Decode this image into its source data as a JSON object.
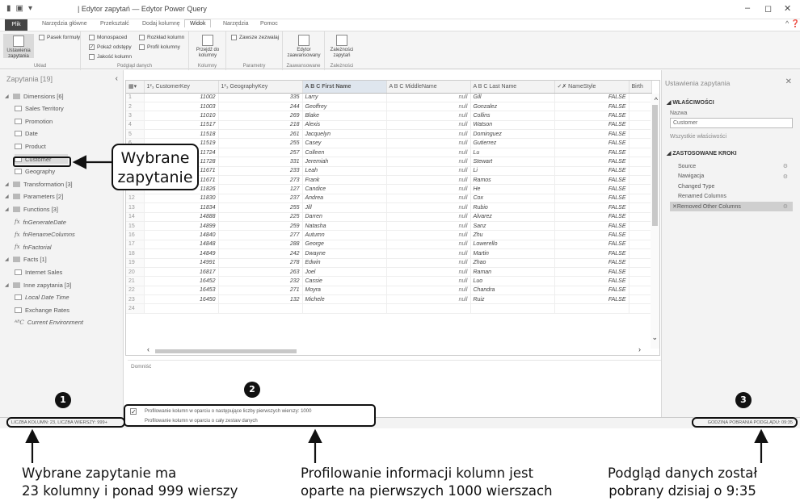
{
  "window": {
    "title": "| Edytor zapytań — Edytor Power Query",
    "controls": [
      "–",
      "◻",
      "✕"
    ]
  },
  "menu": {
    "tabs": [
      "Plik",
      "Narzędzia główne",
      "Przekształć",
      "Dodaj kolumnę",
      "Widok",
      "Narzędzia",
      "Pomoc"
    ],
    "active_tab": "Widok"
  },
  "ribbon": {
    "settings_btn": "Ustawienia zapytania",
    "formula_bar": "Pasek formuły",
    "group_layout": "Układ",
    "monospaced": "Monospaced",
    "show_whitespace": "Pokaż odstępy",
    "column_quality": "Jakość kolumn",
    "column_distribution": "Rozkład kolumn",
    "column_profile": "Profil kolumny",
    "group_preview": "Podgląd danych",
    "goto_column": "Przejdź do kolumny",
    "group_columns": "Kolumny",
    "always_allow": "Zawsze zezwalaj",
    "group_params": "Parametry",
    "advanced_editor": "Edytor zaawansowany",
    "group_advanced": "Zaawansowane",
    "query_deps": "Zależności zapytań",
    "group_deps": "Zależności"
  },
  "queries": {
    "header": "Zapytania [19]",
    "items": [
      {
        "label": "Dimensions [6]",
        "kind": "folder"
      },
      {
        "label": "Sales Territory",
        "kind": "table"
      },
      {
        "label": "Promotion",
        "kind": "table"
      },
      {
        "label": "Date",
        "kind": "table"
      },
      {
        "label": "Product",
        "kind": "table"
      },
      {
        "label": "Customer",
        "kind": "table"
      },
      {
        "label": "Geography",
        "kind": "table"
      },
      {
        "label": "Transformation [3]",
        "kind": "folder"
      },
      {
        "label": "Parameters [2]",
        "kind": "folder"
      },
      {
        "label": "Functions [3]",
        "kind": "folder"
      },
      {
        "label": "fnGenerateDate",
        "kind": "fx"
      },
      {
        "label": "fnRenameColumns",
        "kind": "fx"
      },
      {
        "label": "fnFactorial",
        "kind": "fx"
      },
      {
        "label": "Facts [1]",
        "kind": "folder"
      },
      {
        "label": "Internet Sales",
        "kind": "table"
      },
      {
        "label": "Inne zapytania [3]",
        "kind": "folder"
      },
      {
        "label": "Local Date Time",
        "kind": "clock"
      },
      {
        "label": "Exchange Rates",
        "kind": "table"
      },
      {
        "label": "Current Environment",
        "kind": "abc"
      }
    ]
  },
  "grid": {
    "columns": [
      {
        "label": "1²₃ CustomerKey"
      },
      {
        "label": "1²₃ GeographyKey"
      },
      {
        "label": "A B C First Name"
      },
      {
        "label": "A B C MiddleName"
      },
      {
        "label": "A B C Last Name"
      },
      {
        "label": "✓✗ NameStyle"
      },
      {
        "label": "Birth"
      }
    ],
    "rows": [
      [
        "1",
        "11002",
        "335",
        "Larry",
        "null",
        "Gill",
        "FALSE"
      ],
      [
        "2",
        "11003",
        "244",
        "Geoffrey",
        "null",
        "Gonzalez",
        "FALSE"
      ],
      [
        "3",
        "11010",
        "269",
        "Blake",
        "null",
        "Collins",
        "FALSE"
      ],
      [
        "4",
        "11517",
        "218",
        "Alexis",
        "null",
        "Watson",
        "FALSE"
      ],
      [
        "5",
        "11518",
        "261",
        "Jacquelyn",
        "null",
        "Dominguez",
        "FALSE"
      ],
      [
        "6",
        "11519",
        "255",
        "Casey",
        "null",
        "Gutierrez",
        "FALSE"
      ],
      [
        "7",
        "11724",
        "257",
        "Colleen",
        "null",
        "Lu",
        "FALSE"
      ],
      [
        "8",
        "11728",
        "331",
        "Jeremiah",
        "null",
        "Stewart",
        "FALSE"
      ],
      [
        "9",
        "11671",
        "233",
        "Leah",
        "null",
        "Li",
        "FALSE"
      ],
      [
        "10",
        "11671",
        "273",
        "Frank",
        "null",
        "Ramos",
        "FALSE"
      ],
      [
        "11",
        "11826",
        "127",
        "Candice",
        "null",
        "He",
        "FALSE"
      ],
      [
        "12",
        "11830",
        "237",
        "Andrea",
        "null",
        "Cox",
        "FALSE"
      ],
      [
        "13",
        "11834",
        "255",
        "Jill",
        "null",
        "Rubio",
        "FALSE"
      ],
      [
        "14",
        "14888",
        "225",
        "Darren",
        "null",
        "Alvarez",
        "FALSE"
      ],
      [
        "15",
        "14899",
        "259",
        "Natasha",
        "null",
        "Sanz",
        "FALSE"
      ],
      [
        "16",
        "14840",
        "277",
        "Autumn",
        "null",
        "Zhu",
        "FALSE"
      ],
      [
        "17",
        "14848",
        "288",
        "George",
        "null",
        "Lowerello",
        "FALSE"
      ],
      [
        "18",
        "14849",
        "242",
        "Dwayne",
        "null",
        "Martin",
        "FALSE"
      ],
      [
        "19",
        "14991",
        "278",
        "Edwin",
        "null",
        "Zhao",
        "FALSE"
      ],
      [
        "20",
        "16817",
        "263",
        "Joel",
        "null",
        "Raman",
        "FALSE"
      ],
      [
        "21",
        "16452",
        "232",
        "Cassie",
        "null",
        "Luo",
        "FALSE"
      ],
      [
        "22",
        "16453",
        "271",
        "Moyra",
        "null",
        "Chandra",
        "FALSE"
      ],
      [
        "23",
        "16450",
        "132",
        "Michele",
        "null",
        "Ruiz",
        "FALSE"
      ],
      [
        "24",
        "",
        "",
        "",
        "",
        "",
        ""
      ]
    ],
    "domain_label": "Domniść"
  },
  "profiling": {
    "option1": "Profilowanie kolumn w oparciu o następujące liczby pierwszych wierszy: 1000",
    "option2": "Profilowanie kolumn w oparciu o cały zestaw danych",
    "option1_checked": true
  },
  "settings": {
    "header": "Ustawienia zapytania",
    "props_title": "WŁAŚCIWOŚCI",
    "name_label": "Nazwa",
    "name_value": "Customer",
    "all_props": "Wszystkie właściwości",
    "steps_title": "ZASTOSOWANE KROKI",
    "steps": [
      "Source",
      "Nawigacja",
      "Changed Type",
      "Renamed Columns",
      "Removed Other Columns"
    ],
    "selected_step": "Removed Other Columns"
  },
  "status": {
    "left": "LICZBA KOLUMN: 23, LICZBA WIERSZY: 999+",
    "right": "GODZINA POBRANIA PODGLĄDU: 09:35"
  },
  "annotations": {
    "callout": [
      "Wybrane",
      "zapytanie"
    ],
    "badges": [
      "1",
      "2",
      "3"
    ],
    "caption1": [
      "Wybrane zapytanie ma",
      "23 kolumny i ponad 999 wierszy"
    ],
    "caption2": [
      "Profilowanie informacji kolumn jest",
      "oparte na pierwszych 1000 wierszach"
    ],
    "caption3": [
      "Podgląd danych został",
      "pobrany dzisiaj o 9:35"
    ]
  }
}
